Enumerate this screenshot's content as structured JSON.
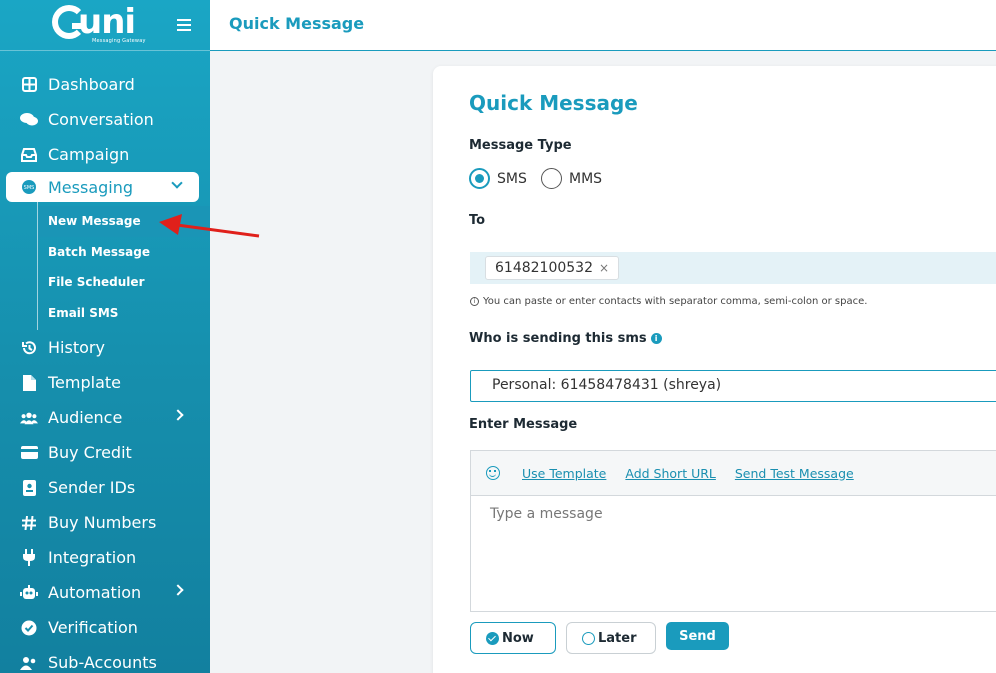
{
  "brand": {
    "logo_text": "uni",
    "tagline": "Messaging Gateway"
  },
  "header": {
    "title": "Quick Message"
  },
  "sidebar": {
    "items": [
      {
        "label": "Dashboard",
        "icon": "dashboard-icon"
      },
      {
        "label": "Conversation",
        "icon": "chat-icon"
      },
      {
        "label": "Campaign",
        "icon": "inbox-icon"
      },
      {
        "label": "Messaging",
        "icon": "sms-icon",
        "expanded": true
      },
      {
        "label": "History",
        "icon": "history-icon"
      },
      {
        "label": "Template",
        "icon": "file-icon"
      },
      {
        "label": "Audience",
        "icon": "users-icon"
      },
      {
        "label": "Buy Credit",
        "icon": "credit-card-icon"
      },
      {
        "label": "Sender IDs",
        "icon": "id-badge-icon"
      },
      {
        "label": "Buy Numbers",
        "icon": "hash-icon"
      },
      {
        "label": "Integration",
        "icon": "plug-icon"
      },
      {
        "label": "Automation",
        "icon": "robot-icon"
      },
      {
        "label": "Verification",
        "icon": "check-circle-icon"
      },
      {
        "label": "Sub-Accounts",
        "icon": "accounts-icon"
      }
    ],
    "submenu": [
      {
        "label": "New Message",
        "active": true
      },
      {
        "label": "Batch Message"
      },
      {
        "label": "File Scheduler"
      },
      {
        "label": "Email SMS"
      }
    ]
  },
  "form": {
    "title": "Quick Message",
    "message_type_label": "Message Type",
    "type_options": [
      "SMS",
      "MMS"
    ],
    "selected_type": "SMS",
    "to_label": "To",
    "to_chip": "61482100532",
    "to_hint": "You can paste or enter contacts with separator comma, semi-colon or space.",
    "sender_label": "Who is sending this sms",
    "sender_value": "Personal: 61458478431 (shreya)",
    "message_label": "Enter Message",
    "tools": [
      "Use Template",
      "Add Short URL",
      "Send Test Message"
    ],
    "message_placeholder": "Type a message",
    "schedule_options": [
      "Now",
      "Later"
    ],
    "send_label": "Send"
  },
  "colors": {
    "accent": "#1a9bbd",
    "annotation_arrow": "#e0201b"
  }
}
